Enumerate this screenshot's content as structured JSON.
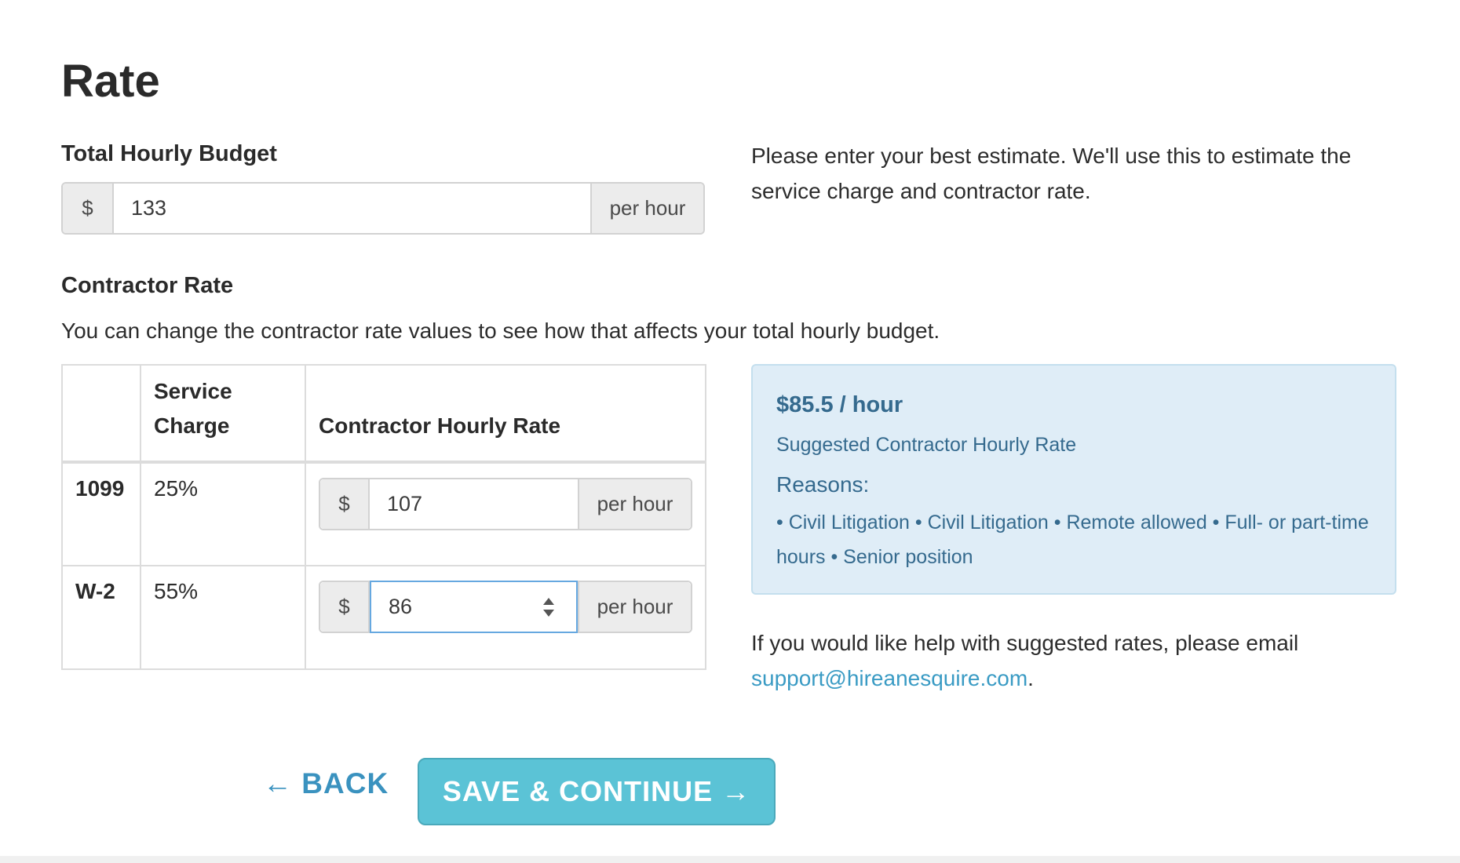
{
  "page": {
    "title": "Rate"
  },
  "budget": {
    "label": "Total Hourly Budget",
    "prefix": "$",
    "value": "133",
    "suffix": "per hour",
    "help": "Please enter your best estimate. We'll use this to estimate the service charge and contractor rate."
  },
  "contractor": {
    "label": "Contractor Rate",
    "help": "You can change the contractor rate values to see how that affects your total hourly budget.",
    "table": {
      "headers": [
        "",
        "Service Charge",
        "Contractor Hourly Rate"
      ],
      "rows": [
        {
          "type": "1099",
          "service_charge": "25%",
          "prefix": "$",
          "rate": "107",
          "suffix": "per hour"
        },
        {
          "type": "W-2",
          "service_charge": "55%",
          "prefix": "$",
          "rate": "86",
          "suffix": "per hour"
        }
      ]
    }
  },
  "suggestion": {
    "amount": "$85.5 / hour",
    "subtitle": "Suggested Contractor Hourly Rate",
    "reasons_title": "Reasons:",
    "reasons": "• Civil Litigation • Civil Litigation • Remote allowed • Full- or part-time hours • Senior position"
  },
  "email_help": {
    "text": "If you would like help with suggested rates, please email",
    "email": "support@hireanesquire.com",
    "trailing": "."
  },
  "actions": {
    "back_label": "← BACK",
    "save_label": "SAVE & CONTINUE →"
  },
  "colors": {
    "accent": "#5bc3d6",
    "link": "#3a9bc4",
    "info_bg": "#dfedf7",
    "info_text": "#356a8e",
    "focus_border": "#66a8e0"
  }
}
